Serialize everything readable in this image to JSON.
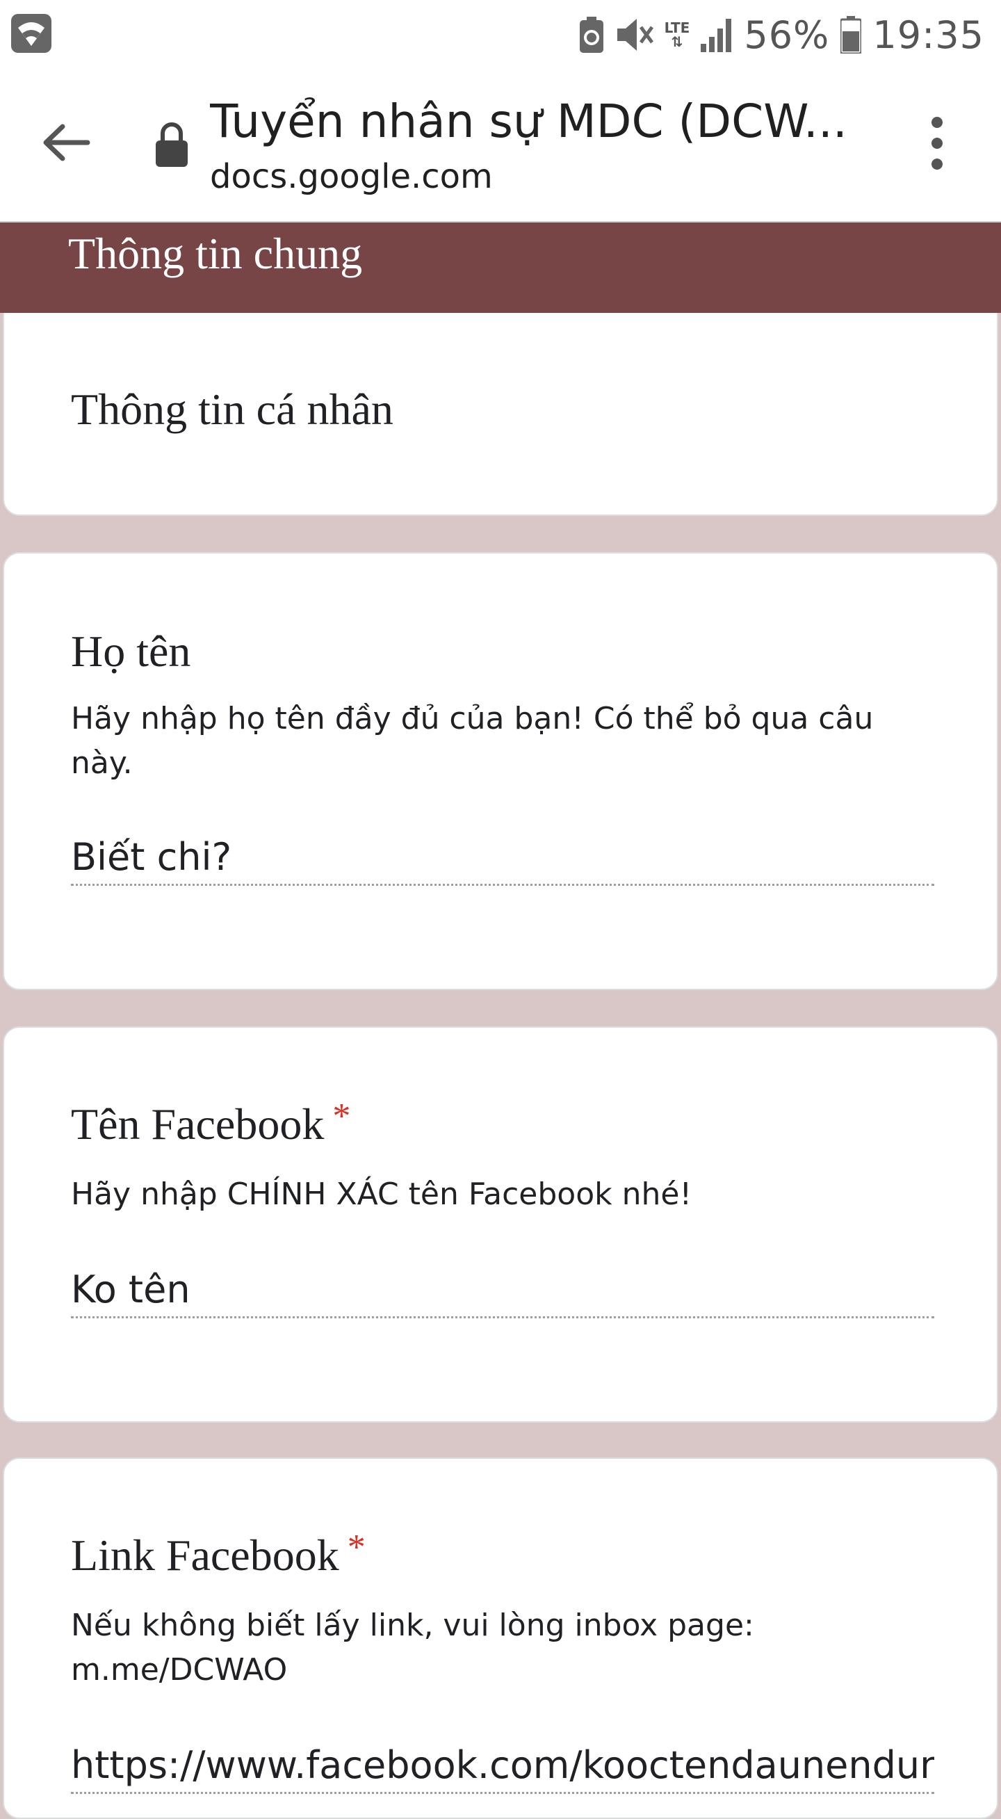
{
  "status_bar": {
    "battery": "56%",
    "time": "19:35",
    "network": "LTE",
    "icons": [
      "wifi-icon",
      "battery-saver-icon",
      "mute-icon",
      "lte-icon",
      "signal-icon",
      "battery-icon"
    ]
  },
  "app_bar": {
    "title": "Tuyển nhân sự MDC (DCW...",
    "url": "docs.google.com",
    "icons": [
      "back-arrow-icon",
      "lock-icon",
      "more-vert-icon"
    ]
  },
  "section": {
    "title": "Thông tin chung"
  },
  "colors": {
    "header": "#774546",
    "page_background": "#d9c6c6",
    "required": "#d93025"
  },
  "form": {
    "section_description": "Thông tin cá nhân",
    "questions": [
      {
        "title": "Họ tên",
        "required": false,
        "description": "Hãy nhập họ tên đầy đủ của bạn! Có thể bỏ qua câu này.",
        "value": "Biết chi?"
      },
      {
        "title": "Tên Facebook",
        "required": true,
        "required_mark": "*",
        "description": "Hãy nhập CHÍNH XÁC tên Facebook nhé!",
        "value": "Ko tên"
      },
      {
        "title": "Link Facebook",
        "required": true,
        "required_mark": "*",
        "description": "Nếu không biết lấy link, vui lòng inbox page: m.me/DCWAO",
        "value": "https://www.facebook.com/kooctendaunendun"
      }
    ]
  }
}
